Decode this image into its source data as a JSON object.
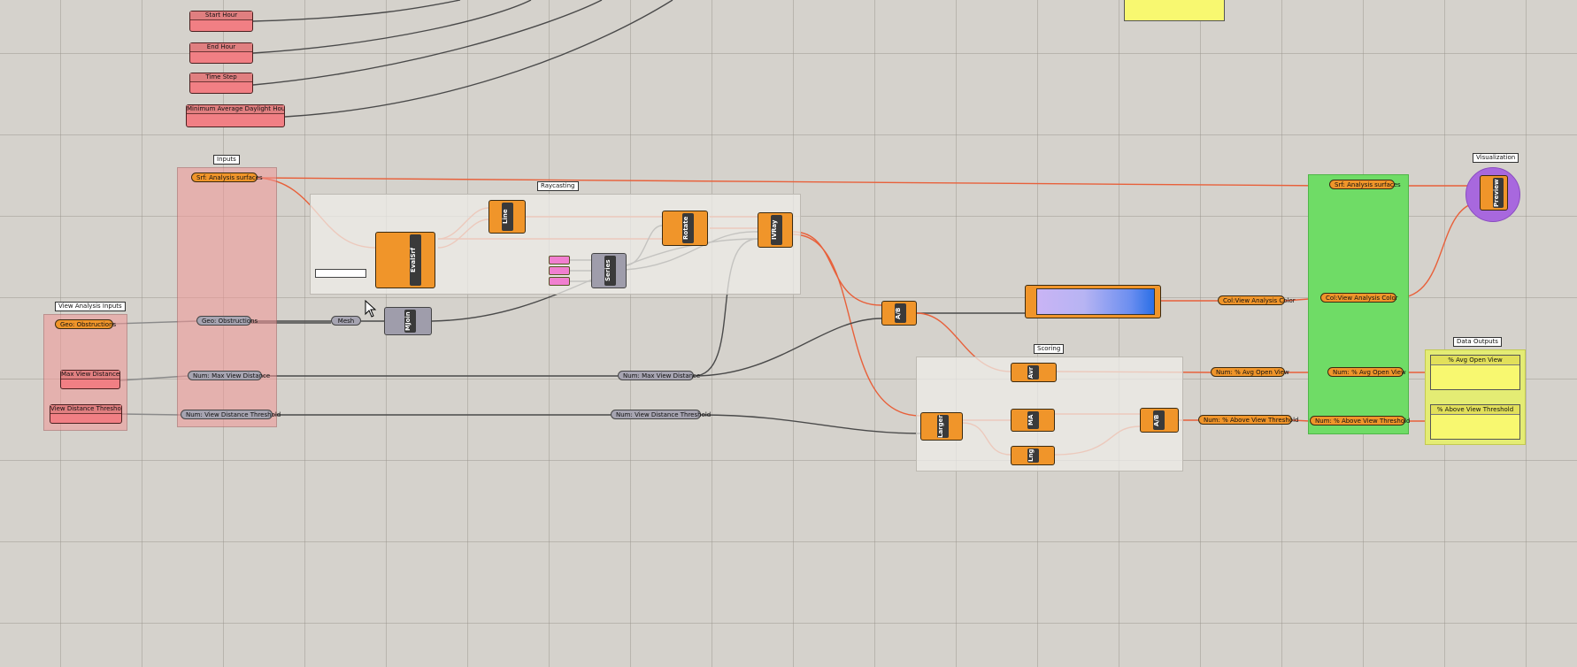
{
  "groups": {
    "inputs": "Inputs",
    "view_analysis_inputs": "View Analysis Inputs",
    "raycasting": "Raycasting",
    "scoring": "Scoring",
    "visualization": "Visualization",
    "data_outputs": "Data Outputs"
  },
  "sliders": {
    "start_hour": "Start Hour",
    "end_hour": "End Hour",
    "time_step": "Time Step",
    "min_avg_daylight": "Minimum Average Daylight Hours",
    "max_view_distance": "Max View Distance",
    "view_distance_threshold": "View Distance Threshold"
  },
  "params": {
    "srf_analysis_surfaces": "Srf: Analysis surfaces",
    "geo_obstructions": "Geo: Obstructions",
    "geo_obstructions_2": "Geo: Obstructions",
    "num_max_view_distance": "Num: Max View Distance",
    "num_view_distance_threshold": "Num: View Distance Threshold",
    "mesh": "Mesh",
    "num_max_view_distance_2": "Num: Max View Distance",
    "num_view_distance_threshold_2": "Num: View Distance Threshold",
    "col_view_analysis_color": "Col:View Analysis Color",
    "col_view_analysis_color_2": "Col:View Analysis Color",
    "num_avg_open_view": "Num: % Avg Open View",
    "num_avg_open_view_2": "Num: % Avg Open View",
    "num_above_view_threshold": "Num: % Above View Threshold",
    "num_above_view_threshold_2": "Num: % Above View Threshold",
    "srf_analysis_surfaces_2": "Srf: Analysis surfaces"
  },
  "components": {
    "evalsrf": "EvalSrf",
    "line": "Line",
    "rotate": "Rotate",
    "ivray": "IVRay",
    "series": "Series",
    "mjoin": "MJoin",
    "ab1": "A/B",
    "avr": "Avr",
    "larger": "Larger",
    "ma": "MA",
    "lng": "Lng",
    "ab2": "A/B",
    "preview": "Preview"
  },
  "panels": {
    "avg_open_view": "% Avg Open View",
    "above_view_threshold": "% Above View Threshold"
  },
  "colors": {
    "param_orange": "#f0952a",
    "param_grey": "#a6a4b1",
    "slider_pink": "#f17f84",
    "group_green": "#6fdc66",
    "group_yellow": "#e4ec74",
    "group_purple": "#a868de",
    "wire_orange": "#e8603a",
    "wire_dark": "#4a4a4a"
  }
}
